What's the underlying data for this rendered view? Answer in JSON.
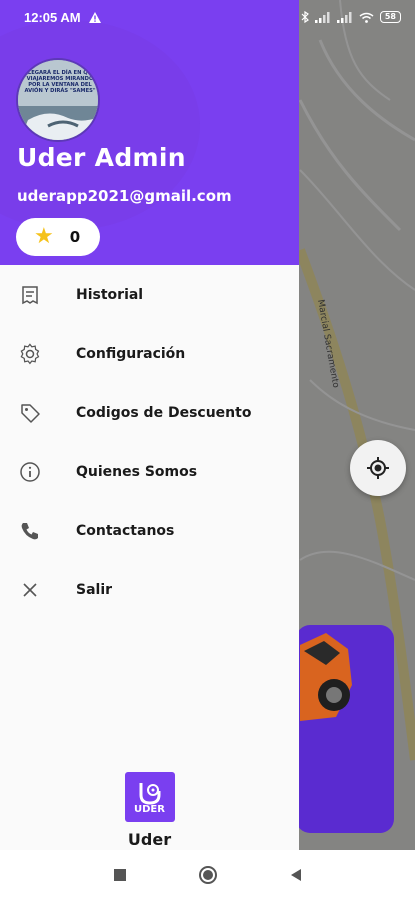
{
  "status_bar": {
    "time": "12:05 AM",
    "battery": "58"
  },
  "drawer": {
    "user": {
      "name": "Uder Admin",
      "email": "uderapp2021@gmail.com",
      "rating": "0",
      "avatar_caption": "LLEGARÁ EL DÍA EN QUE VIAJAREMOS MIRANDO POR LA VENTANA DEL AVIÓN Y DIRÁS \"SAMES\""
    },
    "menu": [
      {
        "label": "Historial",
        "icon": "receipt-icon"
      },
      {
        "label": "Configuración",
        "icon": "gear-icon"
      },
      {
        "label": "Codigos de Descuento",
        "icon": "tag-icon"
      },
      {
        "label": "Quienes Somos",
        "icon": "info-icon"
      },
      {
        "label": "Contactanos",
        "icon": "phone-icon"
      },
      {
        "label": "Salir",
        "icon": "close-icon"
      }
    ],
    "brand": {
      "logo_text": "UDER",
      "name": "Uder"
    }
  },
  "map": {
    "street_label": "Marcial Sacramento"
  },
  "colors": {
    "primary": "#7a3ff0",
    "star": "#f5c21a",
    "promo_card": "#5a2bd0"
  }
}
